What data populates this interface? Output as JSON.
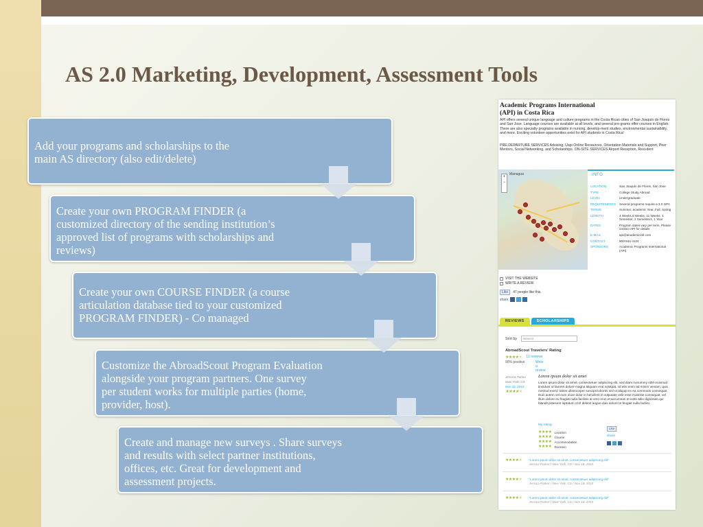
{
  "slide": {
    "title": "AS 2.0 Marketing, Development, Assessment Tools",
    "colors": {
      "top_bar": "#7a6454",
      "left_strip": "#f0dfae",
      "step_box": "#93b2d1",
      "title": "#6b5847"
    }
  },
  "steps": [
    {
      "lines": [
        "Add your programs and scholarships to the",
        "main AS directory (also edit/delete)"
      ]
    },
    {
      "lines": [
        "Create your own PROGRAM FINDER (a",
        "customized directory of the sending institution’s",
        "approved list of programs with scholarships and",
        "reviews)"
      ]
    },
    {
      "lines": [
        "Create your own COURSE FINDER (a course",
        "articulation database tied to your customized",
        "PROGRAM FINDER) - Co managed"
      ]
    },
    {
      "lines": [
        "Customize the AbroadScout Program Evaluation",
        "alongside  your program partners. One survey",
        "per student works for multiple parties (home,",
        "provider, host)."
      ]
    },
    {
      "lines": [
        "Create and manage new surveys . Share surveys",
        "and results with select partner institutions,",
        "offices, etc. Great for development  and",
        "assessment projects."
      ]
    }
  ],
  "screenshot": {
    "title_line1": "Academic Programs International",
    "title_line2": "(API) in Costa Rica",
    "description": "API offers several unique language and culture programs in the Costa Rican cities of San Joaquin de Flores and San Jose. Language courses are available at all levels, and several pro-grams offer courses in English. There are also specialty programs available in nursing, develop-ment studies, environmental sustainability, and more. Exciting volunteer opportunities exist for API students in Costa Rica!",
    "predeparture": "PRE-DEPARTURE SERVICES Advising, Uapi Online Resources, Orientation Materials and Support, Peer Mentors, Social Networking, and Scholarships. ON-SITE SERVICES Airport Reception, Resi-dent",
    "map": {
      "label_left": "Managua",
      "zoom_plus": "+",
      "zoom_minus": "−"
    },
    "info_heading": "INFO",
    "info_rows": [
      {
        "key": "Location",
        "value": "San Joaquin de Flores, San Jose"
      },
      {
        "key": "Type",
        "value": "College Study Abroad"
      },
      {
        "key": "Level",
        "value": "Undergraduate"
      },
      {
        "key": "Requirements",
        "value": "Several programs require a 3.0 GPA"
      },
      {
        "key": "Terms",
        "value": "Summer, academic Year, Fall, Spring"
      },
      {
        "key": "Length",
        "value": "4 Weeks,8 Weeks, 11 Weeks, 1 Semester, 2 Semesters, 1 Year"
      },
      {
        "key": "Dates",
        "value": "Program dates vary per term. Please contact API for details"
      },
      {
        "key": "E-mail",
        "value": "api@academicintl.com"
      },
      {
        "key": "Contact",
        "value": "800-844-4124"
      },
      {
        "key": "Sponsors",
        "value": "Academic Programs International (API)"
      }
    ],
    "links": {
      "visit": "VISIT THE WEBSITE",
      "write": "WRITE A REVIEW"
    },
    "like": {
      "button": "Like",
      "text": "47 people like this."
    },
    "share_label": "share",
    "tabs": [
      "REVIEWS",
      "SCHOLARSHIPS"
    ],
    "sort_label": "Sort by",
    "sort_value": "Newest",
    "rating_title": "AbroadScout Travelers' Rating",
    "stars_filled": "★★★★",
    "stars_empty": "★",
    "reviews_count": "12 reviews",
    "positive": "90% positive",
    "write_link": "Write a review",
    "review": {
      "author": "Jessica Parker",
      "location": "New York, CS",
      "date": "Nov 18, 2010",
      "title": "Lorem ipsum dolor sit amet",
      "body": "Lorem ipsum dolor sit amet, consectetuer adipiscing elit, sed diam nonummy nibh euismod tincidunt ut laoreet dolore magna aliquam erat volutpat. Ut wisi enim ad minim veniam, quis nostrud exerci tation ullamcorper suscipit lobortis nisl ut aliquip ex ea commodo consequat. Duis autem vel eum iriure dolor in hendrerit in vulputate velit esse molestie consequat, vel illum dolore eu feugiat nulla facilisis at vero eros et accumsan et iusto odio dignissim qui blandit praesent luptatum zzril delenit augue duis dolore te feugait nulla facilisi.",
      "my_rating": "My rating",
      "categories": [
        "Location",
        "Course",
        "Accommodation",
        "Duration"
      ],
      "like": "Like",
      "share": "share"
    },
    "short_reviews": [
      {
        "quote": "\"Lorem ipsum dolor sit amet, consectetuer adipiscing elit\"",
        "author": "Jessica Parker / New York, CS / Nov 18, 2010"
      },
      {
        "quote": "\"Lorem ipsum dolor sit amet, consectetuer adipiscing elit\"",
        "author": "Jessica Parker / New York, CS / Nov 18, 2010"
      },
      {
        "quote": "\"Lorem ipsum dolor sit amet, consectetuer adipiscing elit\"",
        "author": "Jessica Parker / New York, CS / Nov 18, 2010"
      }
    ],
    "colors": {
      "accent_blue": "#29a9d9",
      "accent_green": "#d6e23b",
      "star_green": "#9bbd2c",
      "facebook": "#3b5998"
    }
  }
}
